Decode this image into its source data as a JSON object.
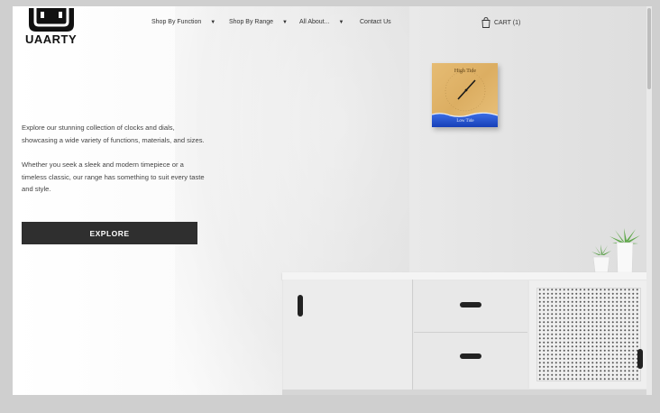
{
  "brand": {
    "name": "UAARTY"
  },
  "nav": [
    {
      "label": "Shop By Function",
      "has_dropdown": true
    },
    {
      "label": "Shop By Range",
      "has_dropdown": true
    },
    {
      "label": "All About...",
      "has_dropdown": true
    },
    {
      "label": "Contact Us",
      "has_dropdown": false
    }
  ],
  "cart": {
    "label": "CART (1)",
    "icon": "shopping-bag-icon"
  },
  "hero": {
    "paragraph1": "Explore our stunning collection of clocks and dials, showcasing a wide variety of functions, materials, and sizes.",
    "paragraph2": "Whether you seek a sleek and modern timepiece or a timeless classic, our range has something to suit every taste and style.",
    "cta_label": "EXPLORE"
  },
  "clock": {
    "top_text": "High Tide",
    "bottom_text": "Low Tide"
  },
  "colors": {
    "button_bg": "#2f2f2f",
    "clock_wood": "#e2b56c",
    "clock_resin": "#1f4fd0"
  }
}
